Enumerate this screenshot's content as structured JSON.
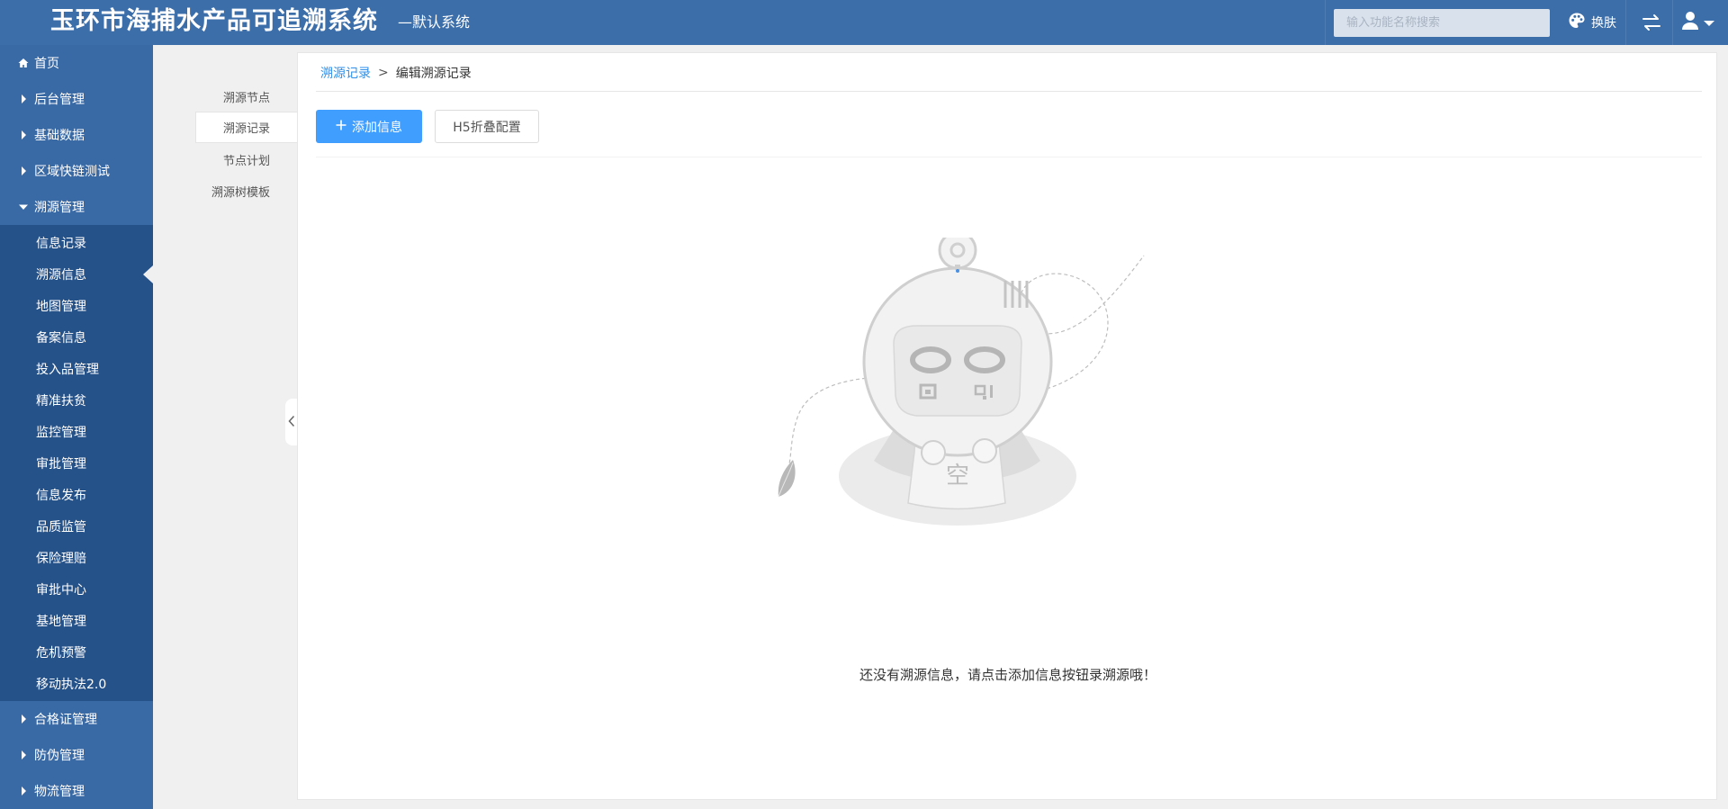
{
  "header": {
    "title": "玉环市海捕水产品可追溯系统",
    "subtitle": "—默认系统",
    "search_placeholder": "输入功能名称搜索",
    "skin_label": "换肤",
    "accent": "#3c6eaa"
  },
  "sidebar": {
    "items": [
      {
        "label": "首页",
        "icon": "home-icon"
      },
      {
        "label": "后台管理",
        "icon": "caret-right-icon"
      },
      {
        "label": "基础数据",
        "icon": "caret-right-icon"
      },
      {
        "label": "区域快链测试",
        "icon": "caret-right-icon"
      },
      {
        "label": "溯源管理",
        "icon": "caret-down-icon"
      }
    ],
    "sub_items": [
      {
        "label": "信息记录"
      },
      {
        "label": "溯源信息"
      },
      {
        "label": "地图管理"
      },
      {
        "label": "备案信息"
      },
      {
        "label": "投入品管理"
      },
      {
        "label": "精准扶贫"
      },
      {
        "label": "监控管理"
      },
      {
        "label": "审批管理"
      },
      {
        "label": "信息发布"
      },
      {
        "label": "品质监管"
      },
      {
        "label": "保险理赔"
      },
      {
        "label": "审批中心"
      },
      {
        "label": "基地管理"
      },
      {
        "label": "危机预警"
      },
      {
        "label": "移动执法2.0"
      }
    ],
    "bottom_items": [
      {
        "label": "合格证管理"
      },
      {
        "label": "防伪管理"
      },
      {
        "label": "物流管理"
      }
    ]
  },
  "secondary_nav": {
    "items": [
      {
        "label": "溯源节点"
      },
      {
        "label": "溯源记录"
      },
      {
        "label": "节点计划"
      },
      {
        "label": "溯源树模板"
      }
    ]
  },
  "main": {
    "breadcrumb": {
      "link": "溯源记录",
      "separator": ">",
      "current": "编辑溯源记录"
    },
    "add_button": "添加信息",
    "h5_button": "H5折叠配置",
    "empty_message": "还没有溯源信息，请点击添加信息按钮录溯源哦！",
    "empty_badge": "空"
  }
}
